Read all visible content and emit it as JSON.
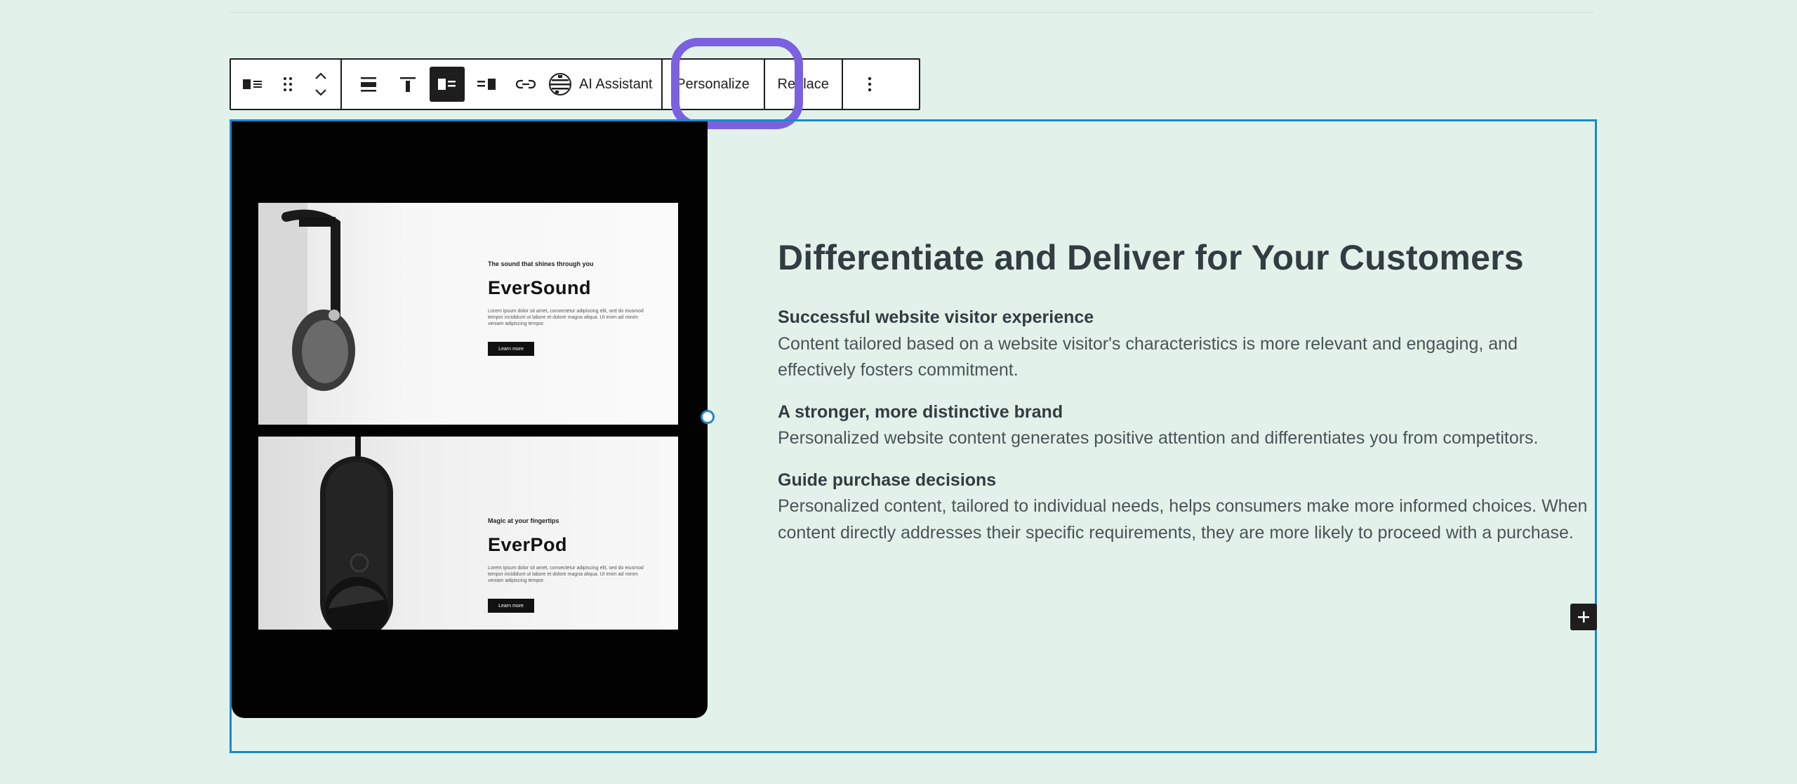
{
  "toolbar": {
    "ai_label": "AI Assistant",
    "personalize_label": "Personalize",
    "replace_label": "Replace"
  },
  "media": {
    "slides": [
      {
        "tag": "The sound that shines through you",
        "title": "EverSound",
        "body": "Lorem ipsum dolor sit amet, consectetur adipiscing elit, sed do eiusmod tempor incididunt ut labore et dolore magna aliqua. Ut enim ad minim veniam adipiscing tempor.",
        "button": "Learn more"
      },
      {
        "tag": "Magic at your fingertips",
        "title": "EverPod",
        "body": "Lorem ipsum dolor sit amet, consectetur adipiscing elit, sed do eiusmod tempor incididunt ut labore et dolore magna aliqua. Ut enim ad minim veniam adipiscing tempor.",
        "button": "Learn more"
      }
    ]
  },
  "content": {
    "heading": "Differentiate and Deliver for Your Customers",
    "items": [
      {
        "title": "Successful website visitor experience",
        "text": "Content tailored based on a website visitor's characteristics is more relevant and engaging, and effectively fosters commitment."
      },
      {
        "title": "A stronger, more distinctive brand",
        "text": "Personalized website content generates positive attention and differentiates you from competitors."
      },
      {
        "title": "Guide purchase decisions",
        "text": "Personalized content, tailored to individual needs, helps consumers make more informed choices. When content directly addresses their specific requirements, they are more likely to proceed with a purchase."
      }
    ]
  },
  "colors": {
    "background": "#e2f2ea",
    "accent": "#1e88c8",
    "highlight": "#7b61df",
    "heading": "#333c41"
  }
}
